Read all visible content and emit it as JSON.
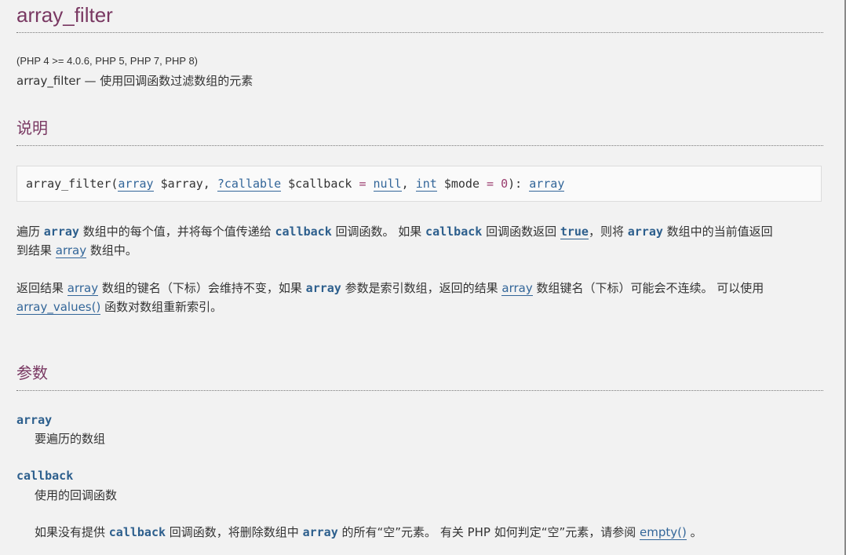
{
  "refname": "array_filter",
  "version": "(PHP 4 >= 4.0.6, PHP 5, PHP 7, PHP 8)",
  "purpose": "array_filter — 使用回调函数过滤数组的元素",
  "sections": {
    "description_title": "说明",
    "parameters_title": "参数"
  },
  "synopsis": {
    "func": "array_filter",
    "open_paren": "(",
    "type1": "array",
    "param1": " $array",
    "comma1": ", ",
    "type2": "?callable",
    "param2": " $callback",
    "eq1": " = ",
    "default2": "null",
    "comma2": ", ",
    "type3": "int",
    "param3": " $mode",
    "eq2": " = ",
    "default3": "0",
    "close": "): ",
    "return_type": "array"
  },
  "desc1": {
    "t1": "遍历 ",
    "c1": "array",
    "t2": " 数组中的每个值，并将每个值传递给 ",
    "c2": "callback",
    "t3": " 回调函数。 如果 ",
    "c3": "callback",
    "t4": " 回调函数返回 ",
    "c4": "true",
    "t5": "，则将 ",
    "c5": "array",
    "t6": " 数组中的当前值返回",
    "t7": "到结果 ",
    "l1": "array",
    "t8": " 数组中。"
  },
  "desc2": {
    "t1": "返回结果 ",
    "l1": "array",
    "t2": " 数组的键名（下标）会维持不变，如果 ",
    "c1": "array",
    "t3": " 参数是索引数组，返回的结果 ",
    "l2": "array",
    "t4": " 数组键名（下标）可能会不连续。 可以使用",
    "l3": "array_values()",
    "t5": " 函数对数组重新索引。"
  },
  "params": {
    "p1_name": "array",
    "p1_desc": "要遍历的数组",
    "p2_name": "callback",
    "p2_desc": "使用的回调函数",
    "p2_note": {
      "t1": "如果没有提供 ",
      "c1": "callback",
      "t2": " 回调函数，将删除数组中 ",
      "c2": "array",
      "t3": " 的所有“空”元素。 有关 PHP 如何判定“空”元素，请参阅 ",
      "l1": "empty()",
      "t4": " 。"
    }
  }
}
